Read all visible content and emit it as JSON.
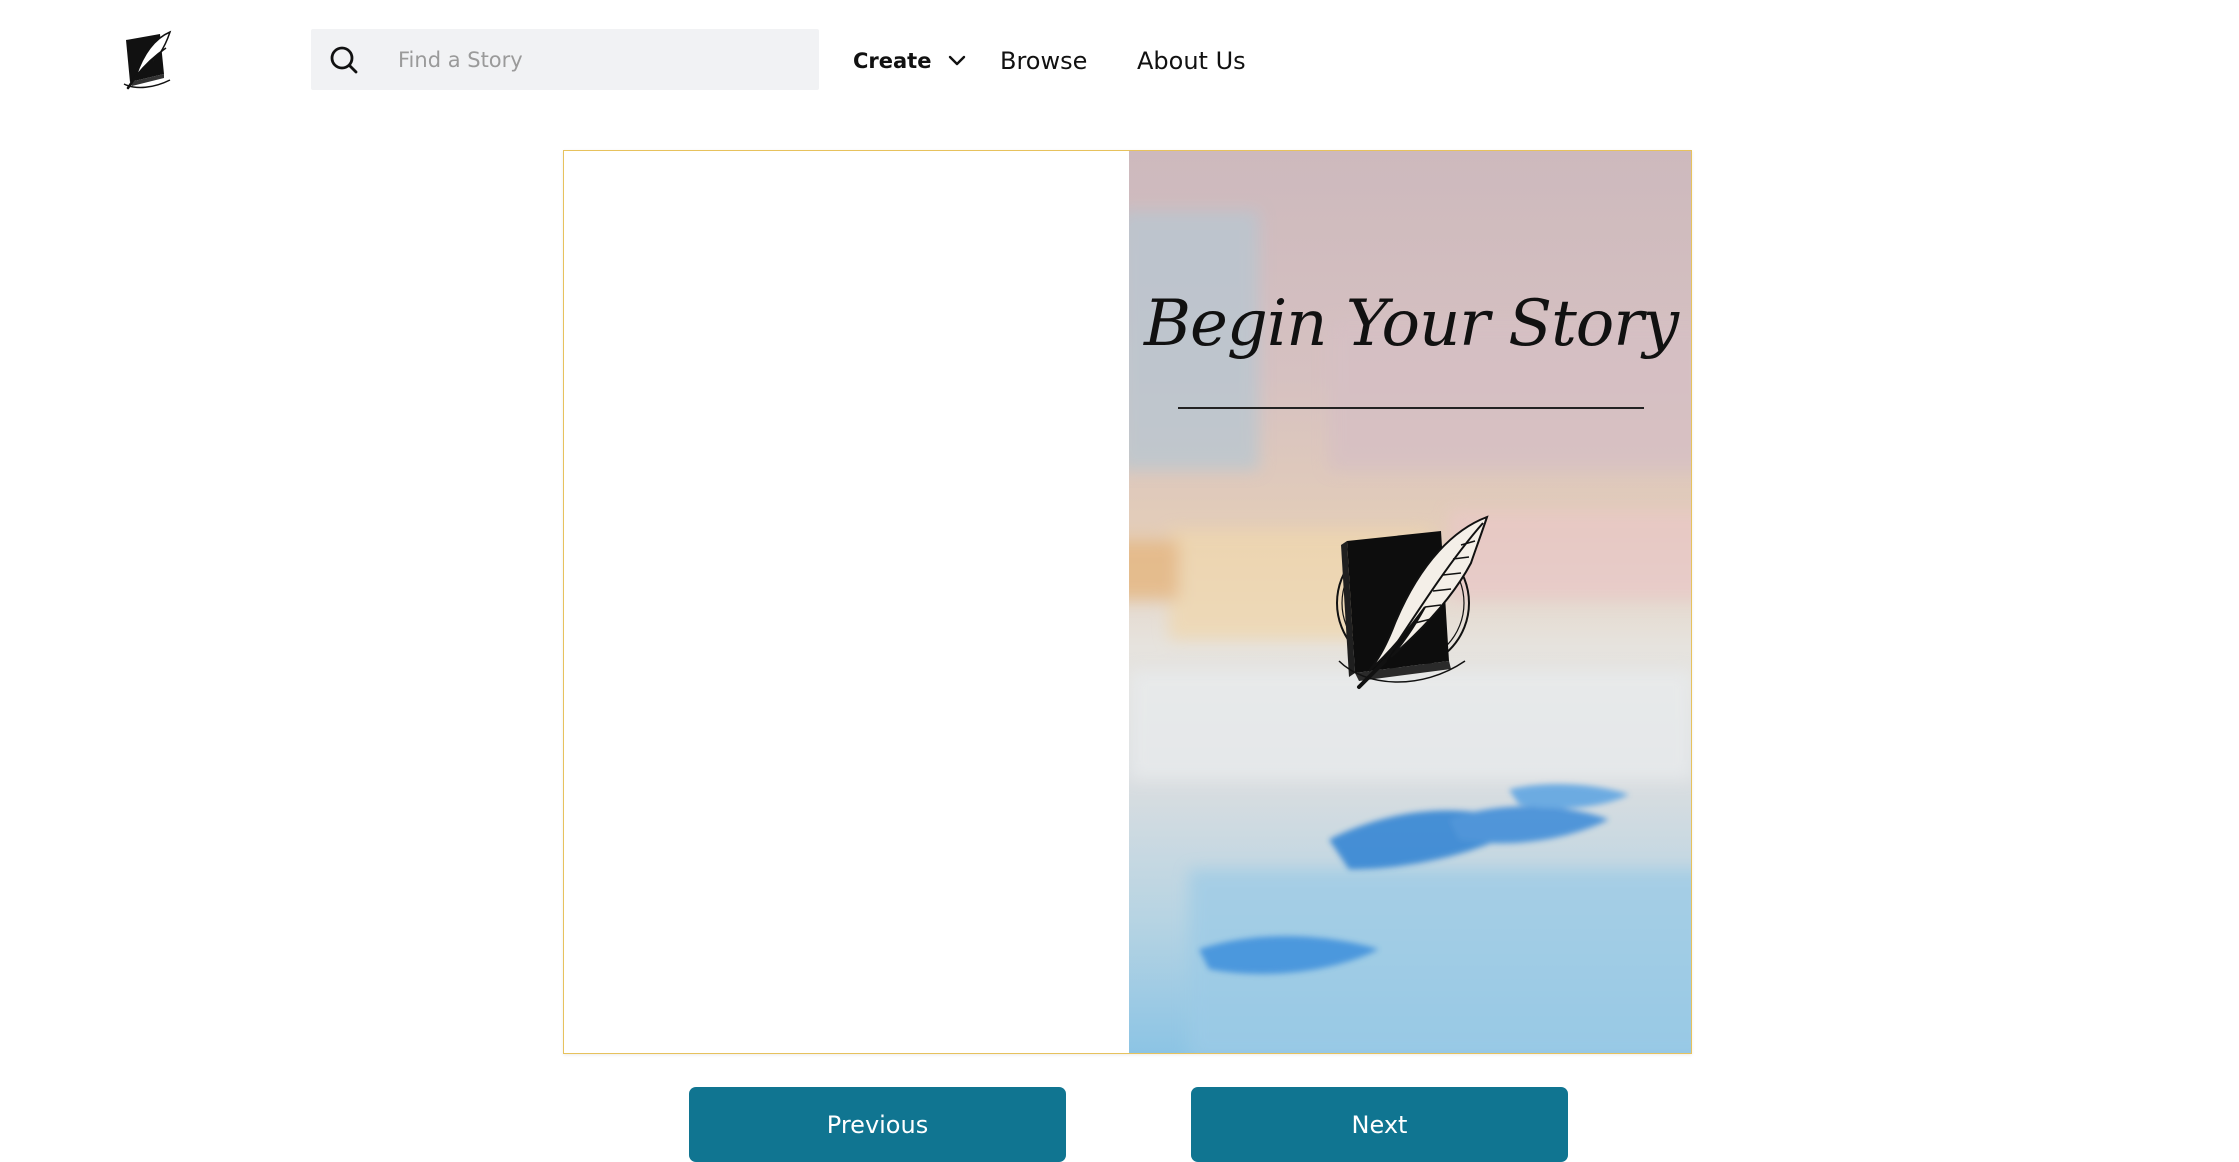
{
  "header": {
    "logo_icon": "quill-book-icon",
    "search": {
      "icon": "search-icon",
      "placeholder": "Find a Story",
      "value": ""
    },
    "nav": {
      "create_label": "Create",
      "create_icon": "chevron-down-icon",
      "browse_label": "Browse",
      "about_label": "About Us"
    }
  },
  "book": {
    "left_page": {
      "content": ""
    },
    "cover": {
      "title": "Begin Your Story",
      "emblem_icon": "quill-book-icon",
      "accent_border_color": "#e7c25d"
    }
  },
  "controls": {
    "previous_label": "Previous",
    "next_label": "Next",
    "button_color": "#107591"
  }
}
